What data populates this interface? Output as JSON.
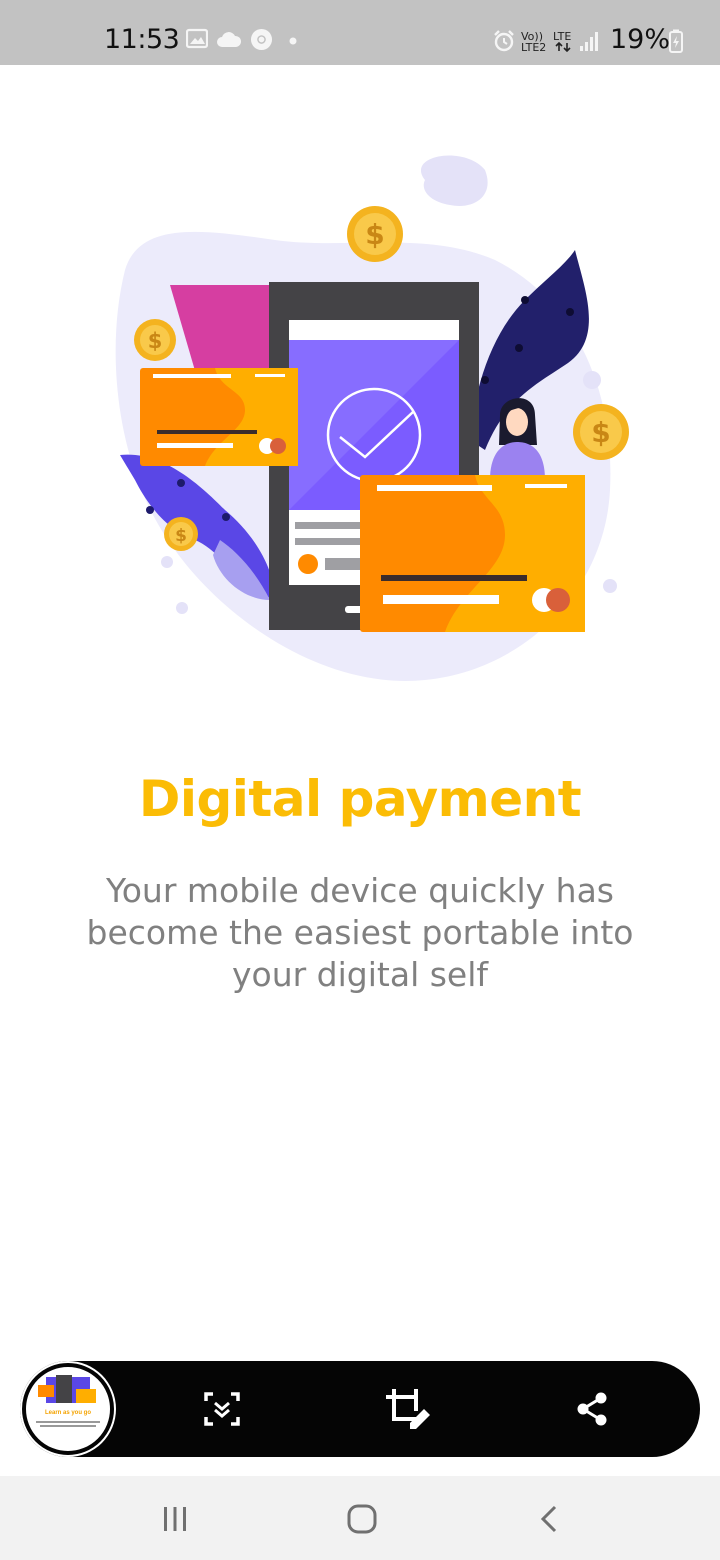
{
  "status_bar": {
    "time": "11:53",
    "battery": "19%",
    "volte": "Vo))",
    "lte2": "LTE2",
    "lte": "LTE",
    "icons": [
      "gallery-icon",
      "cloud-icon",
      "chrome-icon",
      "dot-icon",
      "alarm-icon",
      "signal-icon",
      "battery-charging-icon"
    ]
  },
  "onboarding": {
    "title": "Digital payment",
    "subtitle": "Your mobile device quickly has become the easiest portable into your digital self",
    "illustration": "phone-payment-illustration"
  },
  "screenshot_toolbar": {
    "thumbnail_caption": "Learn as you go",
    "icons": [
      "scroll-capture-icon",
      "crop-edit-icon",
      "share-icon"
    ]
  },
  "nav_bar": {
    "icons": [
      "recents-icon",
      "home-icon",
      "back-icon"
    ]
  },
  "colors": {
    "accent": "#fbbc05",
    "text_secondary": "#808080",
    "card_orange": "#ff8a00",
    "card_yellow": "#ffae00",
    "phone_screen": "#7b5cff",
    "status_bar_bg": "#c2c2c2",
    "toolbar_bg": "#050505"
  }
}
